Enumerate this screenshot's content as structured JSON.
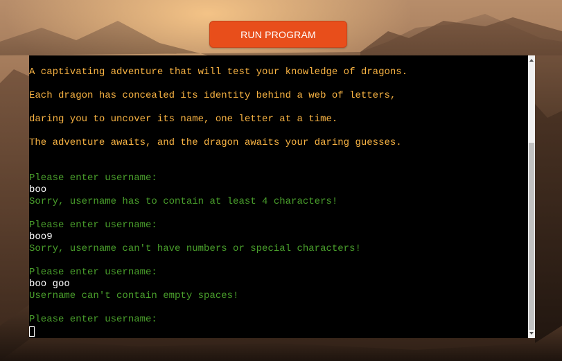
{
  "run_button": {
    "label": "RUN PROGRAM"
  },
  "terminal": {
    "intro": [
      "A captivating adventure that will test your knowledge of dragons.",
      "Each dragon has concealed its identity behind a web of letters,",
      "daring you to uncover its name, one letter at a time.",
      "The adventure awaits, and the dragon awaits your daring guesses."
    ],
    "attempts": [
      {
        "prompt": "Please enter username:",
        "input": "boo",
        "error": "Sorry, username has to contain at least 4 characters!"
      },
      {
        "prompt": "Please enter username:",
        "input": "boo9",
        "error": "Sorry, username can't have numbers or special characters!"
      },
      {
        "prompt": "Please enter username:",
        "input": "boo goo",
        "error": "Username can't contain empty spaces!"
      }
    ],
    "final_prompt": "Please enter username:"
  },
  "colors": {
    "button": "#e84e1b",
    "intro_text": "#f8b343",
    "prompt_text": "#4aa02c",
    "input_text": "#ffffff",
    "terminal_bg": "#000000"
  }
}
